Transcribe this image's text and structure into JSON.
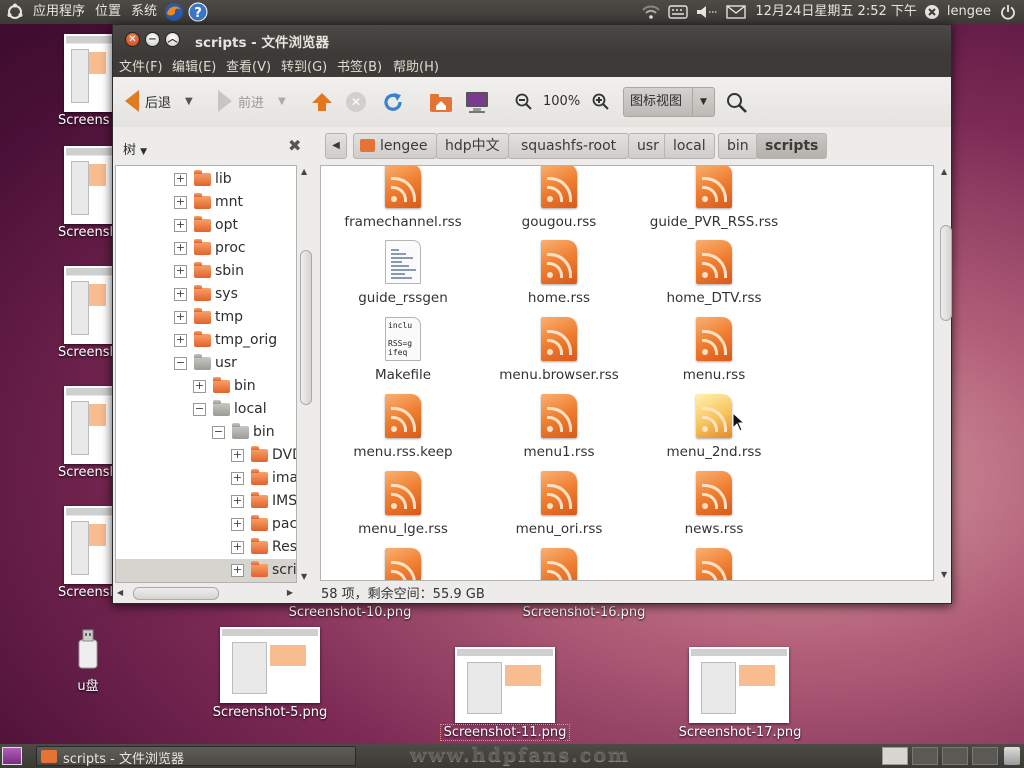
{
  "top_panel": {
    "menus": [
      "应用程序",
      "位置",
      "系统"
    ],
    "clock": "12月24日星期五  2:52 下午",
    "user": "lengee"
  },
  "desktop": {
    "left_icons": [
      "Screens",
      "Screensh",
      "Screensh",
      "Screensh",
      "Screensh"
    ],
    "usb_label": "u盘",
    "files": [
      {
        "label": "Screenshot-10.png"
      },
      {
        "label": "Screenshot-16.png"
      },
      {
        "label": "Screenshot-5.png"
      },
      {
        "label": "Screenshot-11.png"
      },
      {
        "label": "Screenshot-17.png"
      }
    ]
  },
  "window": {
    "title": "scripts - 文件浏览器",
    "menu": [
      "文件(F)",
      "编辑(E)",
      "查看(V)",
      "转到(G)",
      "书签(B)",
      "帮助(H)"
    ],
    "toolbar": {
      "back": "后退",
      "forward": "前进",
      "zoom": "100%",
      "view_mode": "图标视图"
    },
    "breadcrumbs": [
      "lengee",
      "hdp中文",
      "squashfs-root",
      "usr",
      "local",
      "bin",
      "scripts"
    ],
    "sidebar": {
      "title": "树",
      "rows": [
        {
          "label": "lib",
          "depth": 0,
          "exp": "+",
          "color": "o"
        },
        {
          "label": "mnt",
          "depth": 0,
          "exp": "+",
          "color": "o"
        },
        {
          "label": "opt",
          "depth": 0,
          "exp": "+",
          "color": "o"
        },
        {
          "label": "proc",
          "depth": 0,
          "exp": "+",
          "color": "o"
        },
        {
          "label": "sbin",
          "depth": 0,
          "exp": "+",
          "color": "o"
        },
        {
          "label": "sys",
          "depth": 0,
          "exp": "+",
          "color": "o"
        },
        {
          "label": "tmp",
          "depth": 0,
          "exp": "+",
          "color": "o"
        },
        {
          "label": "tmp_orig",
          "depth": 0,
          "exp": "+",
          "color": "o"
        },
        {
          "label": "usr",
          "depth": 0,
          "exp": "−",
          "color": "g"
        },
        {
          "label": "bin",
          "depth": 1,
          "exp": "+",
          "color": "o"
        },
        {
          "label": "local",
          "depth": 1,
          "exp": "−",
          "color": "g"
        },
        {
          "label": "bin",
          "depth": 2,
          "exp": "−",
          "color": "g"
        },
        {
          "label": "DVD",
          "depth": 3,
          "exp": "+",
          "color": "o"
        },
        {
          "label": "ima",
          "depth": 3,
          "exp": "+",
          "color": "o"
        },
        {
          "label": "IMS",
          "depth": 3,
          "exp": "+",
          "color": "o"
        },
        {
          "label": "pac",
          "depth": 3,
          "exp": "+",
          "color": "o"
        },
        {
          "label": "Res",
          "depth": 3,
          "exp": "+",
          "color": "o"
        },
        {
          "label": "scri",
          "depth": 3,
          "exp": "+",
          "color": "o",
          "selected": true
        }
      ]
    },
    "files": [
      {
        "name": "framechannel.rss",
        "type": "rss"
      },
      {
        "name": "gougou.rss",
        "type": "rss"
      },
      {
        "name": "guide_PVR_RSS.rss",
        "type": "rss"
      },
      {
        "name": "guide_rssgen",
        "type": "text"
      },
      {
        "name": "home.rss",
        "type": "rss"
      },
      {
        "name": "home_DTV.rss",
        "type": "rss"
      },
      {
        "name": "Makefile",
        "type": "make"
      },
      {
        "name": "menu.browser.rss",
        "type": "rss"
      },
      {
        "name": "menu.rss",
        "type": "rss"
      },
      {
        "name": "menu.rss.keep",
        "type": "rss"
      },
      {
        "name": "menu1.rss",
        "type": "rss"
      },
      {
        "name": "menu_2nd.rss",
        "type": "rss-hover"
      },
      {
        "name": "menu_lge.rss",
        "type": "rss"
      },
      {
        "name": "menu_ori.rss",
        "type": "rss"
      },
      {
        "name": "news.rss",
        "type": "rss"
      },
      {
        "name": "",
        "type": "rss"
      },
      {
        "name": "",
        "type": "rss"
      },
      {
        "name": "",
        "type": "rss"
      }
    ],
    "makefile_preview": "inclu\n\nRSS=g\nifeq",
    "status": "58 项，剩余空间：55.9 GB"
  },
  "bottom_panel": {
    "task": "scripts - 文件浏览器",
    "watermark": "www.hdpfans.com"
  },
  "colors": {
    "accent": "#e07b22",
    "panel": "#3c3b37",
    "selection": "#d6d4cf"
  }
}
